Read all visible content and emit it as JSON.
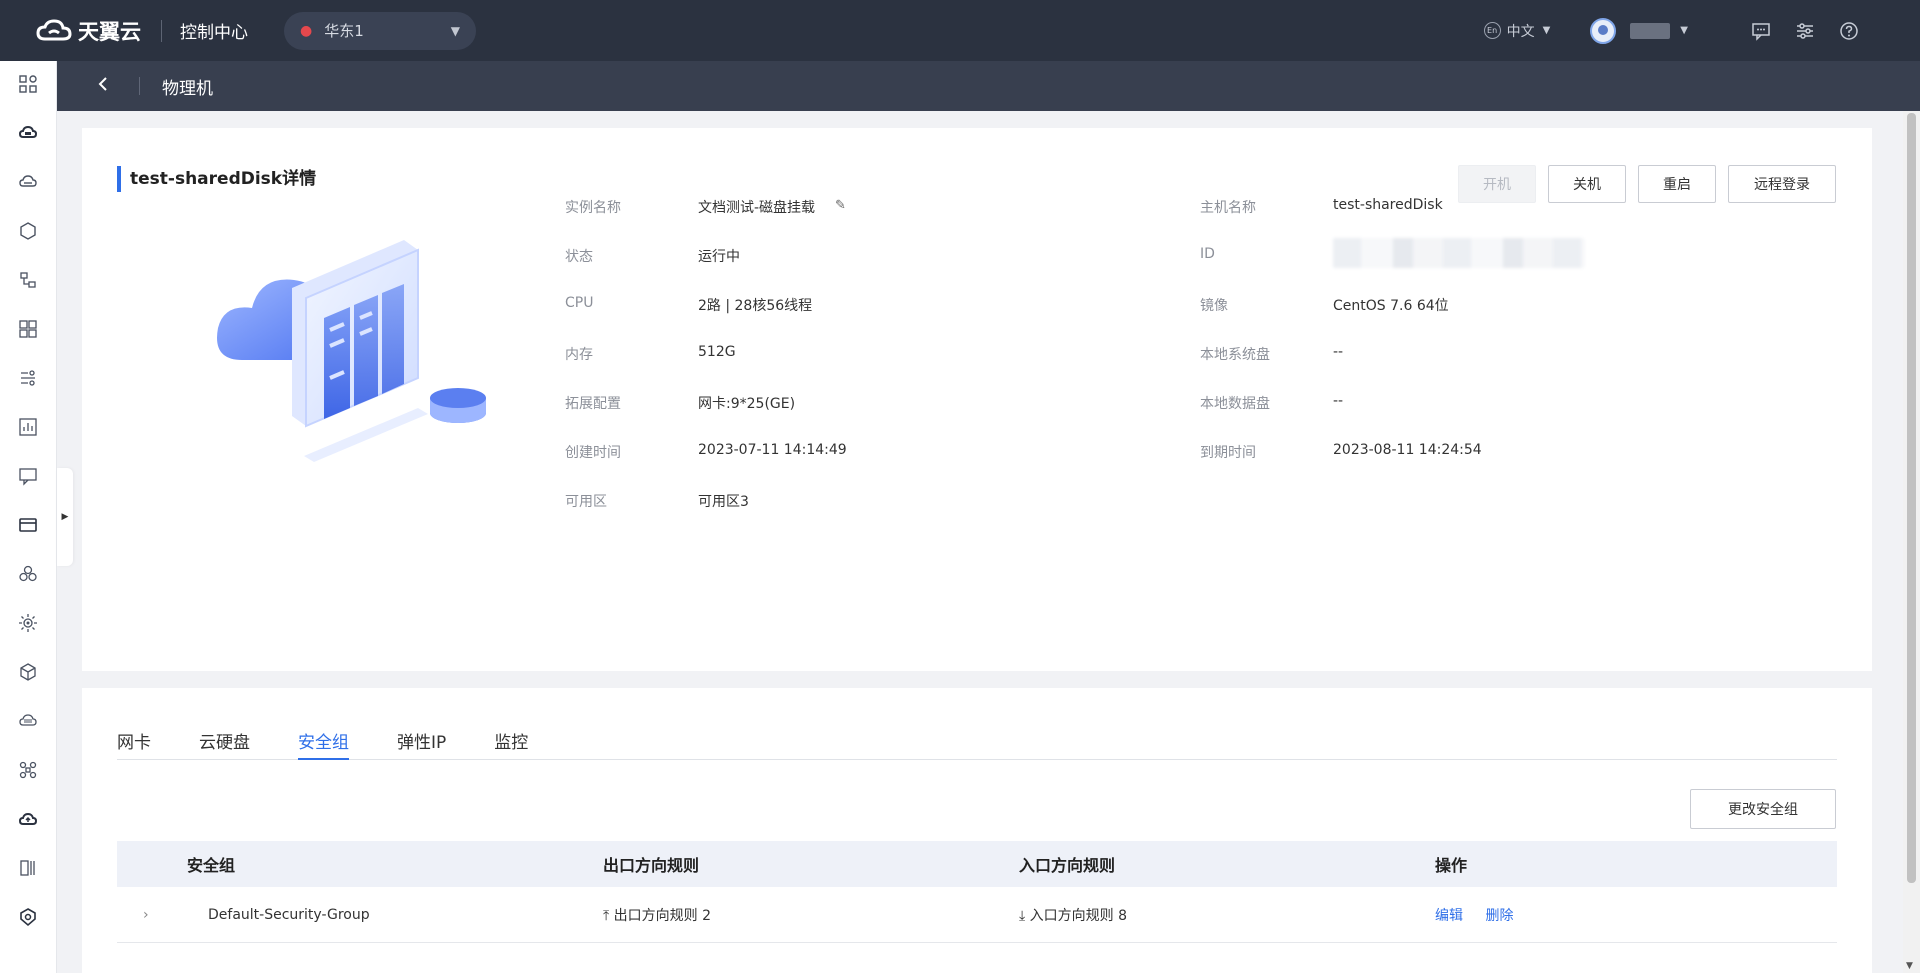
{
  "header": {
    "brand": "天翼云",
    "console_title": "控制中心",
    "region": "华东1",
    "lang_badge": "En",
    "lang": "中文"
  },
  "subheader": {
    "title": "物理机"
  },
  "detail": {
    "title": "test-sharedDisk详情",
    "actions": {
      "start": "开机",
      "shutdown": "关机",
      "restart": "重启",
      "remote_login": "远程登录"
    },
    "left_fields": [
      {
        "key": "实例名称",
        "value": "文档测试-磁盘挂载"
      },
      {
        "key": "状态",
        "value": "运行中"
      },
      {
        "key": "CPU",
        "value": "2路 | 28核56线程"
      },
      {
        "key": "内存",
        "value": "512G"
      },
      {
        "key": "拓展配置",
        "value": "网卡:9*25(GE)"
      },
      {
        "key": "创建时间",
        "value": "2023-07-11 14:14:49"
      },
      {
        "key": "可用区",
        "value": "可用区3"
      }
    ],
    "right_fields": [
      {
        "key": "主机名称",
        "value": "test-sharedDisk"
      },
      {
        "key": "ID",
        "value": ""
      },
      {
        "key": "镜像",
        "value": "CentOS 7.6 64位"
      },
      {
        "key": "本地系统盘",
        "value": "--"
      },
      {
        "key": "本地数据盘",
        "value": "--"
      },
      {
        "key": "到期时间",
        "value": "2023-08-11 14:24:54"
      }
    ]
  },
  "tabs": [
    "网卡",
    "云硬盘",
    "安全组",
    "弹性IP",
    "监控"
  ],
  "active_tab": "安全组",
  "change_sg_button": "更改安全组",
  "table": {
    "headers": [
      "安全组",
      "出口方向规则",
      "入口方向规则",
      "操作"
    ],
    "rows": [
      {
        "name": "Default-Security-Group",
        "egress": "出口方向规则 2",
        "ingress": "入口方向规则 8",
        "edit": "编辑",
        "delete": "删除"
      }
    ]
  },
  "colors": {
    "topbar": "#2b3240",
    "subheader": "#383f4f",
    "accent": "#2f6fe8",
    "region_pin": "#e5484d"
  }
}
